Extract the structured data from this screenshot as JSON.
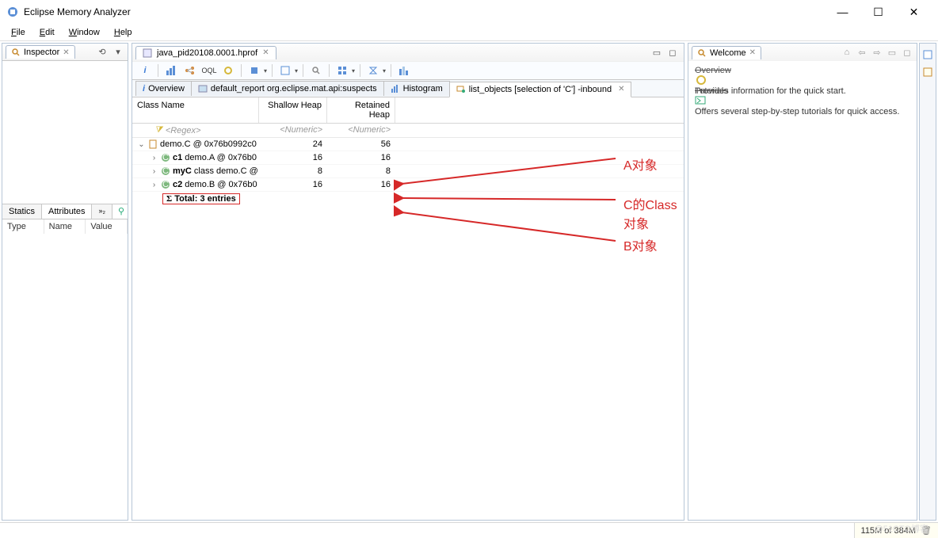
{
  "app": {
    "title": "Eclipse Memory Analyzer"
  },
  "menu": {
    "file": "File",
    "edit": "Edit",
    "window": "Window",
    "help": "Help"
  },
  "inspector": {
    "tab": "Inspector",
    "tabs": {
      "statics": "Statics",
      "attributes": "Attributes"
    },
    "cols": {
      "type": "Type",
      "name": "Name",
      "value": "Value"
    }
  },
  "editor": {
    "file_tab": "java_pid20108.0001.hprof"
  },
  "inner_tabs": {
    "overview": "Overview",
    "default_report": "default_report  org.eclipse.mat.api:suspects",
    "histogram": "Histogram",
    "list_objects": "list_objects [selection of 'C'] -inbound"
  },
  "tree": {
    "headers": {
      "classname": "Class Name",
      "shallow": "Shallow Heap",
      "retained": "Retained Heap"
    },
    "filter": {
      "regex": "<Regex>",
      "numeric": "<Numeric>"
    },
    "rows": [
      {
        "indent": 0,
        "expander": "v",
        "obj": "file",
        "text": "demo.C @ 0x76b0992c0",
        "shallow": "24",
        "retained": "56"
      },
      {
        "indent": 1,
        "expander": ">",
        "obj": "class",
        "bold": "c1",
        "text": " demo.A @ 0x76b0",
        "shallow": "16",
        "retained": "16"
      },
      {
        "indent": 1,
        "expander": ">",
        "obj": "class",
        "bold": "myC",
        "text": " class demo.C @",
        "shallow": "8",
        "retained": "8"
      },
      {
        "indent": 1,
        "expander": ">",
        "obj": "class",
        "bold": "c2",
        "text": " demo.B @ 0x76b0",
        "shallow": "16",
        "retained": "16"
      }
    ],
    "total": "Total: 3 entries"
  },
  "annotations": {
    "a": "A对象",
    "c": "C的Class对象",
    "b": "B对象"
  },
  "welcome": {
    "tab": "Welcome",
    "overview_label": "Overview",
    "overview_desc": "Provides information for the quick start.",
    "tutorials_label": "Tutorials",
    "tutorials_desc": "Offers several step-by-step tutorials for quick access."
  },
  "status": {
    "memory": "115M of 384M"
  },
  "watermark": "@51CTO博客"
}
